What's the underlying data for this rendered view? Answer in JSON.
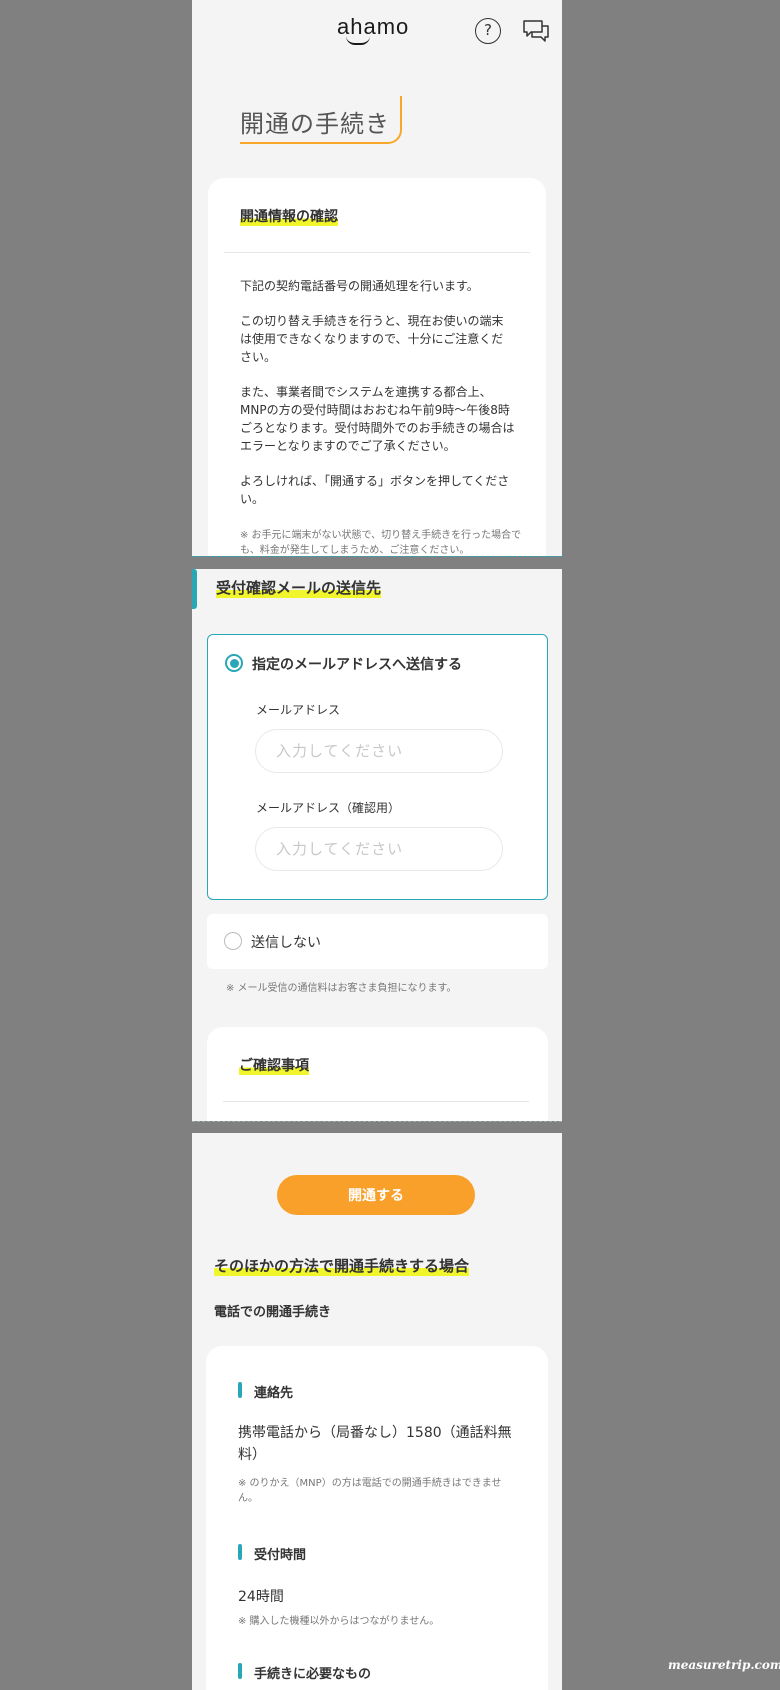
{
  "header": {
    "logo": "ahamo",
    "help_glyph": "?",
    "icons": [
      "help-icon",
      "chat-icon"
    ]
  },
  "page": {
    "title": "開通の手続き"
  },
  "confirm_card": {
    "title": "開通情報の確認",
    "paragraphs": [
      "下記の契約電話番号の開通処理を行います。",
      "この切り替え手続きを行うと、現在お使いの端末は使用できなくなりますので、十分にご注意ください。",
      "また、事業者間でシステムを連携する都合上、MNPの方の受付時間はおおむね午前9時〜午後8時ごろとなります。受付時間外でのお手続きの場合はエラーとなりますのでご了承ください。",
      "よろしければ、「開通する」ボタンを押してください。"
    ],
    "note": "※ お手元に端末がない状態で、切り替え手続きを行った場合でも、料金が発生してしまうため、ご注意ください。"
  },
  "mail_section": {
    "title": "受付確認メールの送信先",
    "option_send": "指定のメールアドレスへ送信する",
    "email_label": "メールアドレス",
    "email_placeholder": "入力してください",
    "email_confirm_label": "メールアドレス（確認用）",
    "email_confirm_placeholder": "入力してください",
    "option_no_send": "送信しない",
    "note": "※ メール受信の通信料はお客さま負担になります。"
  },
  "confirm_items": {
    "title": "ご確認事項"
  },
  "cta": {
    "label": "開通する"
  },
  "other_methods": {
    "title": "そのほかの方法で開通手続きする場合",
    "phone_subtitle": "電話での開通手続き",
    "contact_title": "連絡先",
    "contact_text": "携帯電話から（局番なし）1580（通話料無料）",
    "contact_note": "※ のりかえ（MNP）の方は電話での開通手続きはできません。",
    "hours_title": "受付時間",
    "hours_text": "24時間",
    "hours_note": "※ 購入した機種以外からはつながりません。",
    "required_title": "手続きに必要なもの"
  },
  "watermark": "measuretrip.com",
  "colors": {
    "accent": "#2aa7b6",
    "cta": "#f9a02a",
    "highlight": "#f1f52b",
    "title_underline": "#f8a72a"
  }
}
